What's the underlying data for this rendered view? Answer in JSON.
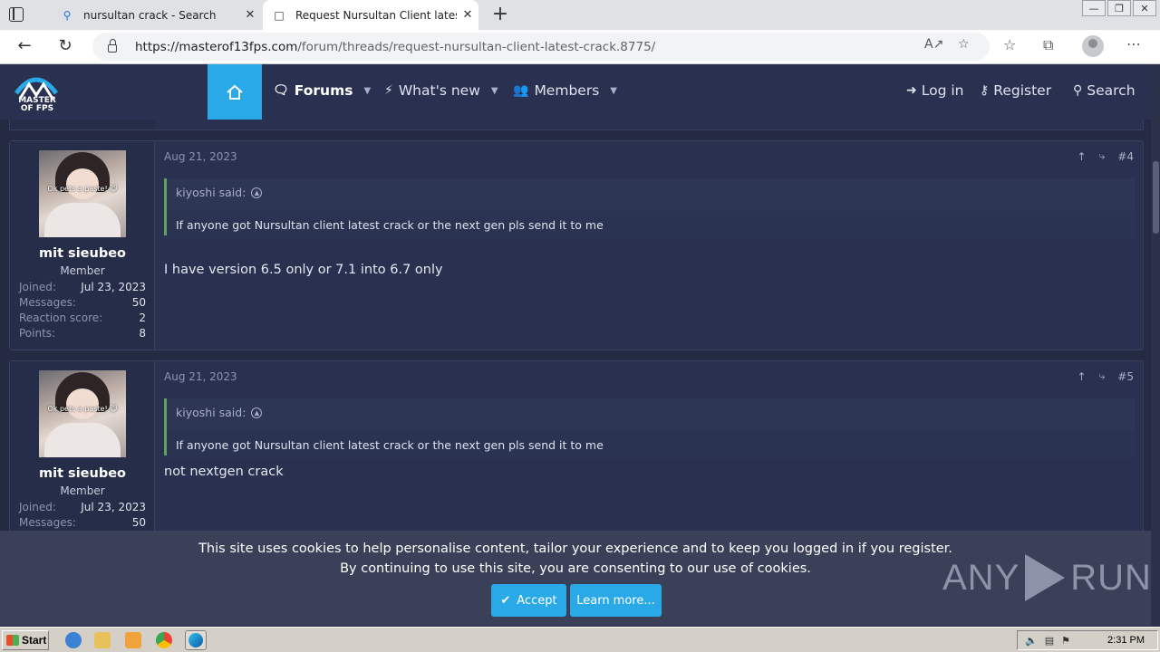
{
  "browser": {
    "tabs": [
      {
        "label": "nursultan crack - Search",
        "icon": "search-icon"
      },
      {
        "label": "Request Nursultan Client latest",
        "icon": "page-icon"
      }
    ],
    "url_host": "https://masterof13fps.com",
    "url_path": "/forum/threads/request-nursultan-client-latest-crack.8775/"
  },
  "site": {
    "logo_line1": "MASTER",
    "logo_line2": "OF  FPS",
    "nav": {
      "forums": "Forums",
      "whats_new": "What's new",
      "members": "Members",
      "login": "Log in",
      "register": "Register",
      "search": "Search"
    }
  },
  "posts": [
    {
      "date": "Aug 21, 2023",
      "number": "#4",
      "username": "mit sieubeo",
      "user_title": "Member",
      "avatar_caption": "Ok pets a paste! 😺",
      "stats": [
        {
          "k": "Joined:",
          "v": "Jul 23, 2023"
        },
        {
          "k": "Messages:",
          "v": "50"
        },
        {
          "k": "Reaction score:",
          "v": "2"
        },
        {
          "k": "Points:",
          "v": "8"
        }
      ],
      "quote_author": "kiyoshi said:",
      "quote_text": "If anyone got Nursultan client latest crack or the next gen pls send it to me",
      "text": "I have version 6.5 only or 7.1 into 6.7 only"
    },
    {
      "date": "Aug 21, 2023",
      "number": "#5",
      "username": "mit sieubeo",
      "user_title": "Member",
      "avatar_caption": "Ok pets a paste! 😺",
      "stats": [
        {
          "k": "Joined:",
          "v": "Jul 23, 2023"
        },
        {
          "k": "Messages:",
          "v": "50"
        }
      ],
      "quote_author": "kiyoshi said:",
      "quote_text": "If anyone got Nursultan client latest crack or the next gen pls send it to me",
      "text": "not nextgen crack"
    }
  ],
  "cookie": {
    "line1": "This site uses cookies to help personalise content, tailor your experience and to keep you logged in if you register.",
    "line2": "By continuing to use this site, you are consenting to our use of cookies.",
    "accept": "Accept",
    "learn_more": "Learn more..."
  },
  "watermark": {
    "left": "ANY",
    "right": "RUN"
  },
  "taskbar": {
    "start": "Start",
    "clock": "2:31 PM"
  },
  "colors": {
    "accent": "#29a9e8",
    "header_bg": "#2a3150",
    "page_bg": "#232a42",
    "quote_border": "#5fa25f"
  }
}
